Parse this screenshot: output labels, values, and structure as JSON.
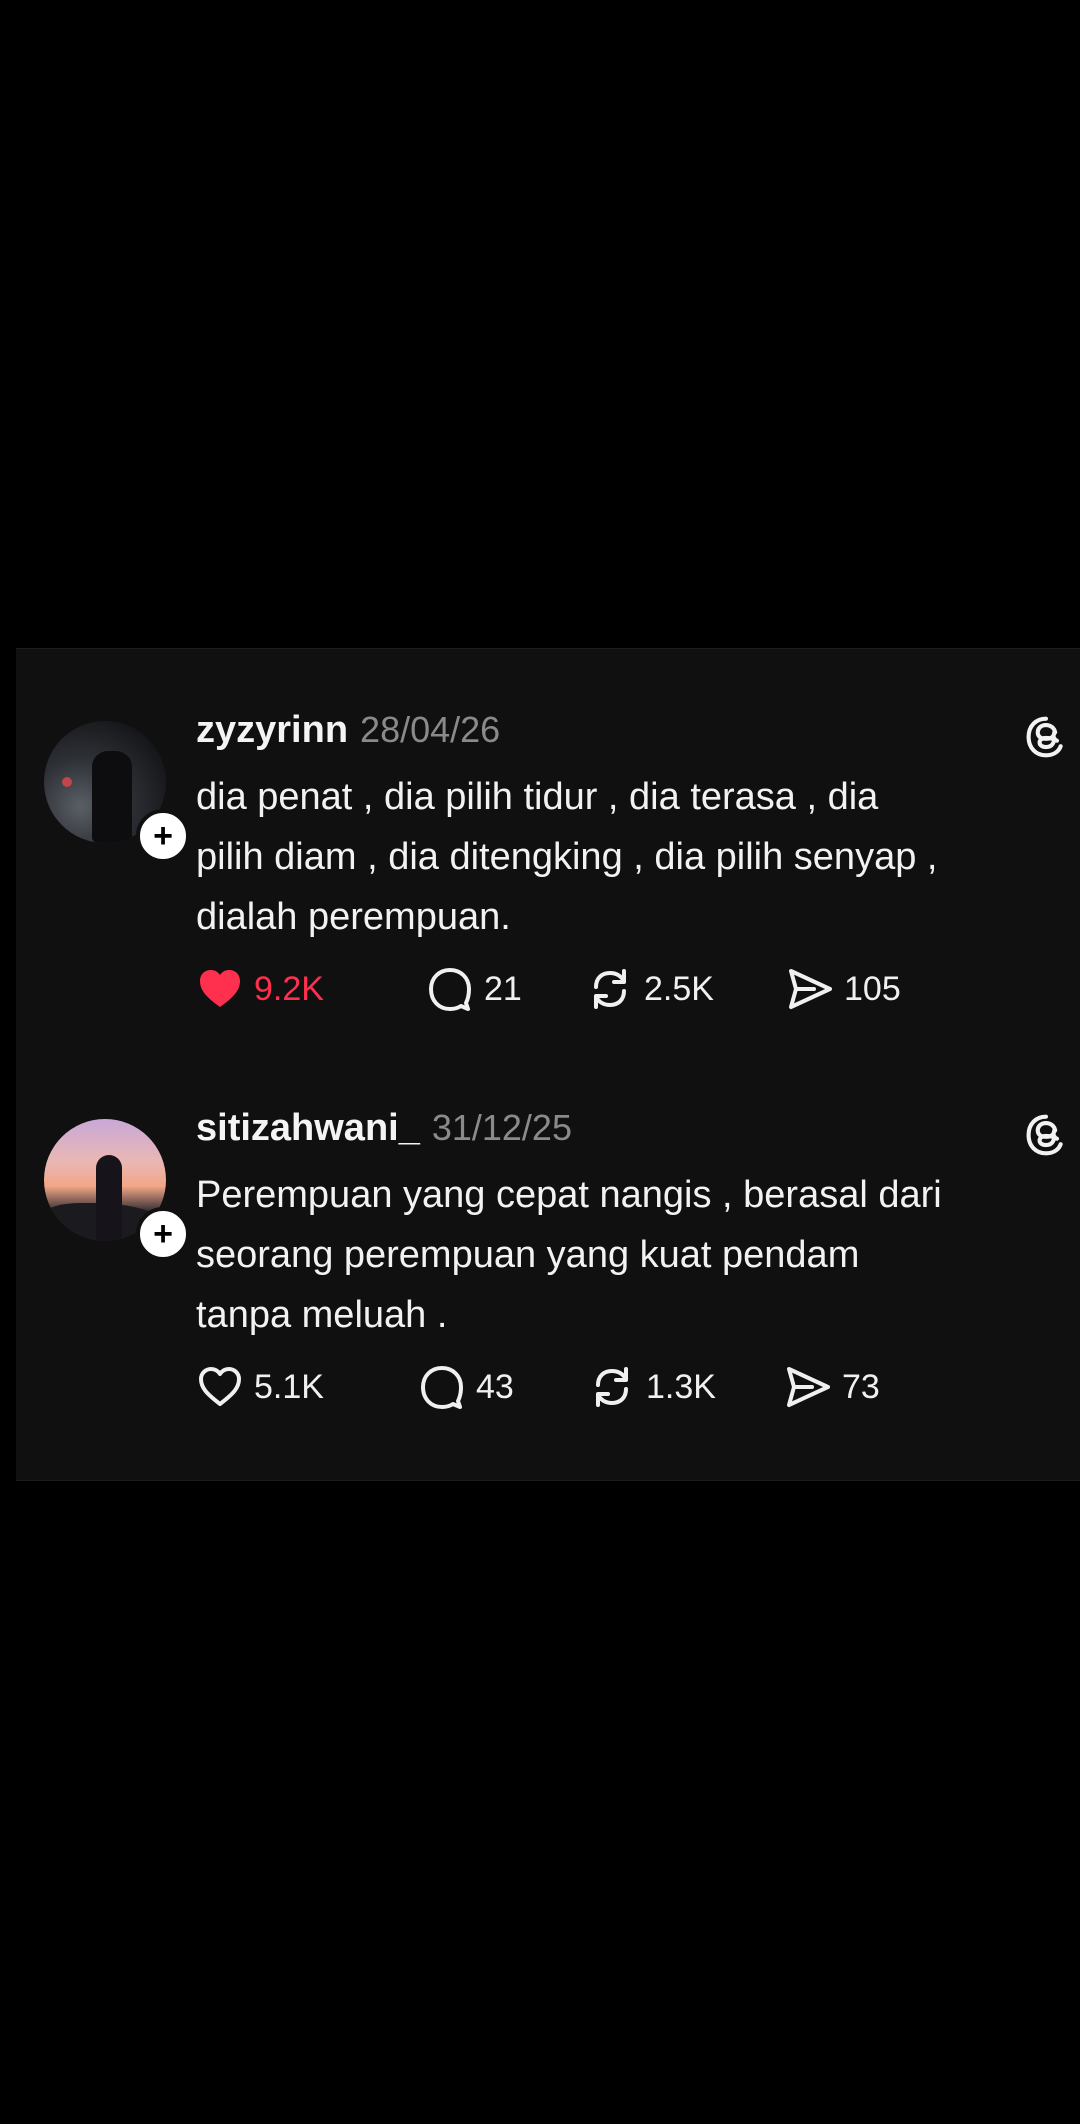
{
  "colors": {
    "background": "#000000",
    "card_background": "#101010",
    "like_active": "#ff2f4e",
    "date_text": "#8a8a8a"
  },
  "posts": [
    {
      "username": "zyzyrinn",
      "date": "28/04/26",
      "body_lines": [
        "dia penat , dia pilih tidur , dia terasa , dia",
        "pilih diam , dia ditengking , dia pilih senyap ,",
        "dialah perempuan."
      ],
      "liked": true,
      "likes": "9.2K",
      "replies": "21",
      "reposts": "2.5K",
      "shares": "105",
      "icons": [
        "avatar-photo",
        "plus-icon",
        "threads-logo-icon",
        "heart-filled-icon",
        "comment-icon",
        "repost-icon",
        "share-icon"
      ]
    },
    {
      "username": "sitizahwani_",
      "date": "31/12/25",
      "body_lines": [
        "Perempuan yang cepat nangis , berasal dari",
        "seorang perempuan yang kuat pendam",
        "tanpa meluah ."
      ],
      "liked": false,
      "likes": "5.1K",
      "replies": "43",
      "reposts": "1.3K",
      "shares": "73",
      "icons": [
        "avatar-photo",
        "plus-icon",
        "threads-logo-icon",
        "heart-outline-icon",
        "comment-icon",
        "repost-icon",
        "share-icon"
      ]
    }
  ],
  "follow_symbol": "+"
}
